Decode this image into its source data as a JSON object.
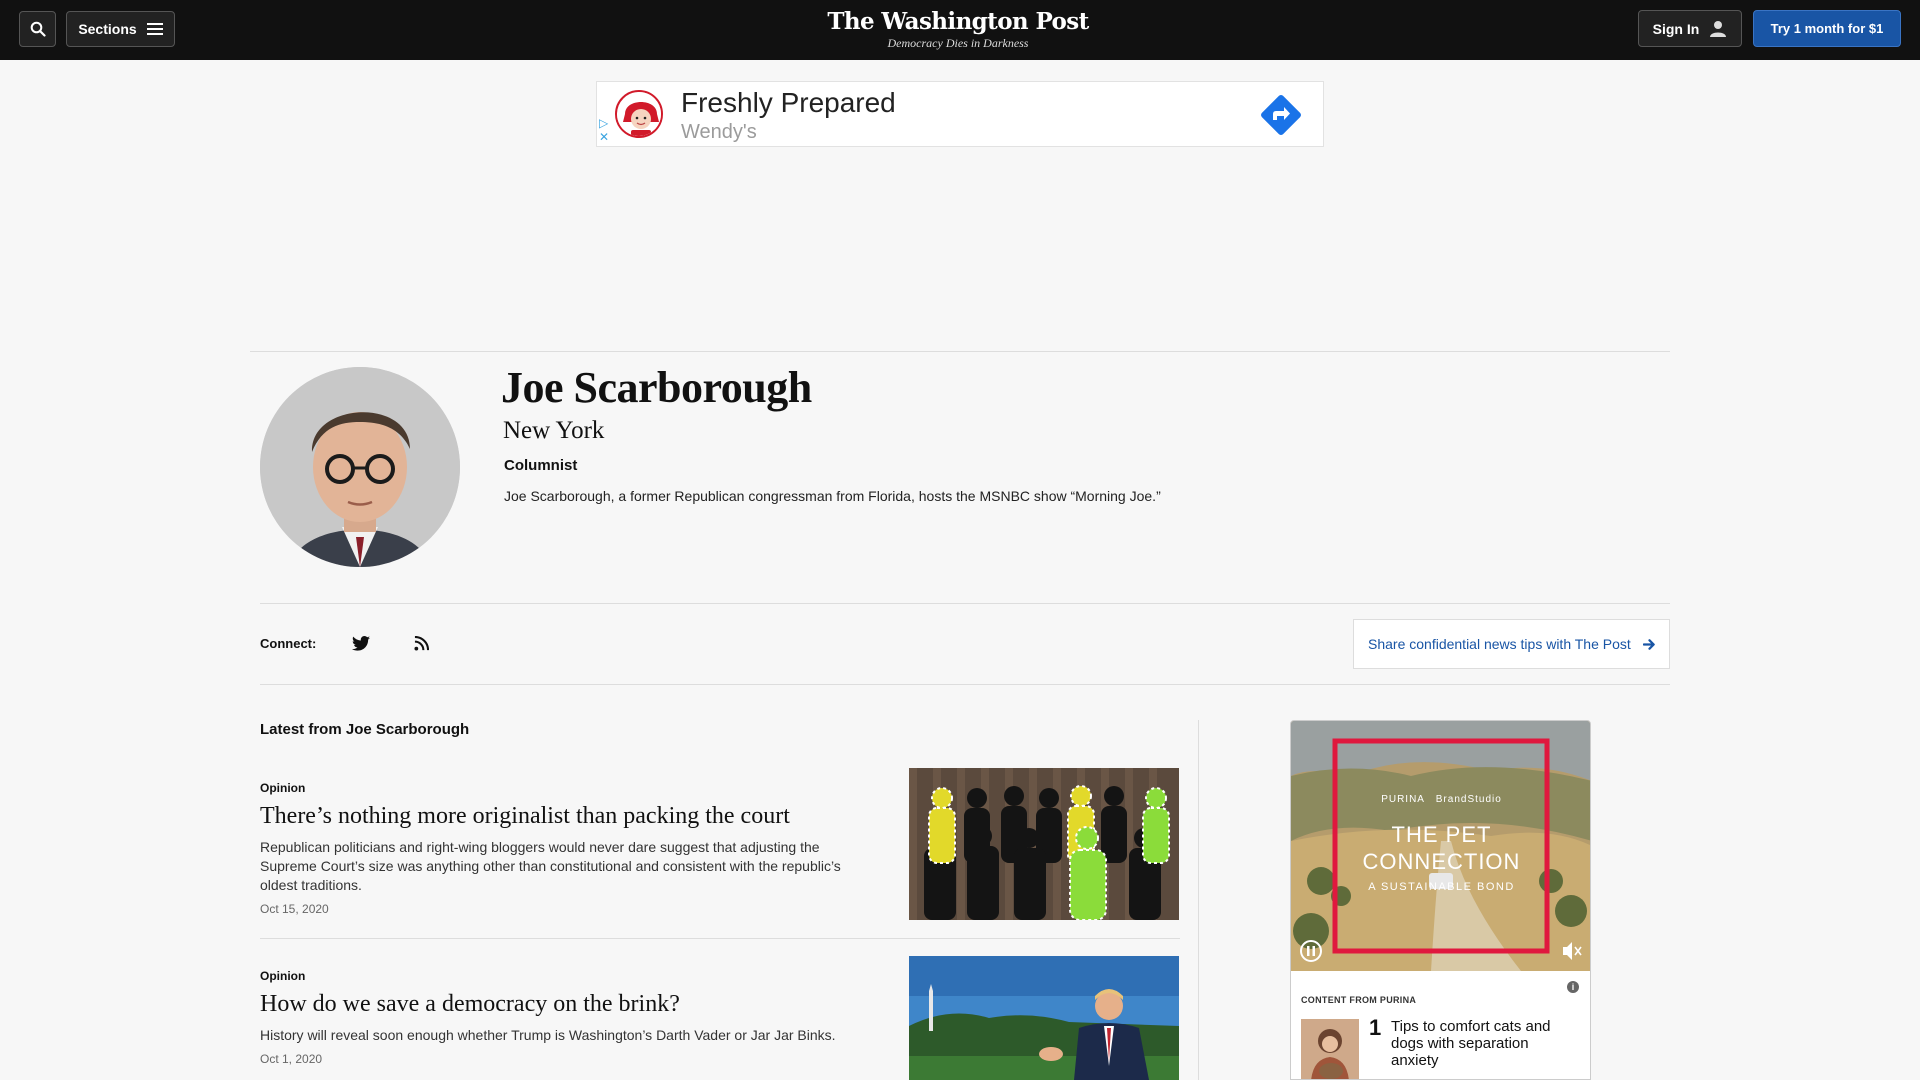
{
  "header": {
    "search_label": "Search",
    "sections_label": "Sections",
    "masthead": "The Washington Post",
    "tagline": "Democracy Dies in Darkness",
    "signin_label": "Sign In",
    "trial_label": "Try 1 month for $1"
  },
  "ad_banner": {
    "title": "Freshly Prepared",
    "advertiser": "Wendy's"
  },
  "profile": {
    "name": "Joe Scarborough",
    "location": "New York",
    "role": "Columnist",
    "bio": "Joe Scarborough, a former Republican congressman from Florida, hosts the MSNBC show “Morning Joe.”"
  },
  "connect": {
    "label": "Connect:",
    "icons": [
      "twitter-icon",
      "rss-icon"
    ],
    "tips_label": "Share confidential news tips with The Post"
  },
  "feed": {
    "title": "Latest from Joe Scarborough",
    "articles": [
      {
        "kicker": "Opinion",
        "headline": "There’s nothing more originalist than packing the court",
        "blurb": "Republican politicians and right-wing bloggers would never dare suggest that adjusting the Supreme Court’s size was anything other than constitutional and consistent with the republic’s oldest traditions.",
        "date": "Oct 15, 2020"
      },
      {
        "kicker": "Opinion",
        "headline": "How do we save a democracy on the brink?",
        "blurb": "History will reveal soon enough whether Trump is Washington’s Darth Vader or Jar Jar Binks.",
        "date": "Oct 1, 2020"
      }
    ]
  },
  "side_ad": {
    "brand_line": "PURINA",
    "studio": "BrandStudio",
    "headline": "THE PET CONNECTION",
    "subhead": "A SUSTAINABLE BOND",
    "sponsor_label": "CONTENT FROM PURINA",
    "item_number": "1",
    "item_text": "Tips to comfort cats and dogs with separation anxiety"
  },
  "colors": {
    "accent": "#1955a5",
    "nav_bg": "#111111",
    "page_bg": "#f7f7f7"
  }
}
